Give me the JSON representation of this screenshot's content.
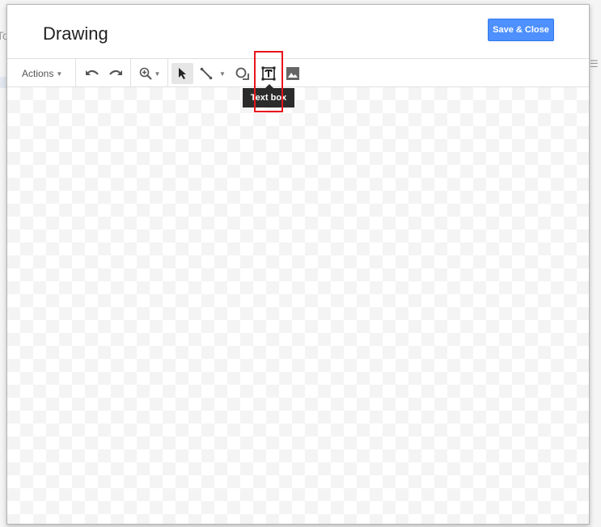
{
  "background": {
    "partial_text": "To"
  },
  "dialog": {
    "title": "Drawing",
    "save_close_label": "Save & Close"
  },
  "toolbar": {
    "actions_label": "Actions",
    "items": [
      {
        "name": "undo",
        "icon": "undo-icon"
      },
      {
        "name": "redo",
        "icon": "redo-icon"
      },
      {
        "name": "zoom",
        "icon": "zoom-in-icon",
        "has_dropdown": true
      },
      {
        "name": "select",
        "icon": "cursor-arrow-icon",
        "active": true
      },
      {
        "name": "line",
        "icon": "line-icon",
        "has_dropdown": true
      },
      {
        "name": "shape",
        "icon": "shape-icon"
      },
      {
        "name": "text-box",
        "icon": "text-box-icon",
        "highlighted": true
      },
      {
        "name": "image",
        "icon": "image-icon"
      }
    ]
  },
  "tooltip": {
    "text": "Text box"
  },
  "colors": {
    "primary_button": "#4d90fe",
    "highlight": "#e8141c",
    "tooltip_bg": "#2b2b2b"
  }
}
